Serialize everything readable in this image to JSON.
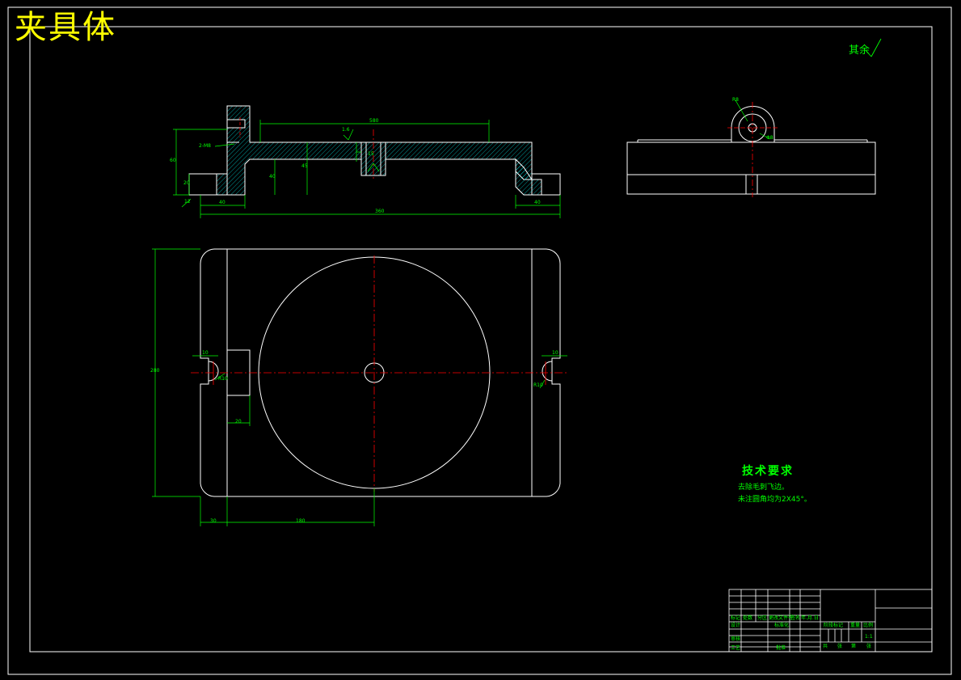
{
  "drawing": {
    "title": "夹具体",
    "roughness_note": "其余",
    "tech_requirements": {
      "title": "技术要求",
      "lines": [
        "去除毛刺飞边。",
        "未注圆角均为2X45°。"
      ]
    },
    "dimensions": {
      "section_top_width": "580",
      "section_overall_length": "360",
      "section_left_end": "40",
      "section_right_end": "40",
      "section_height": "60",
      "section_base_height": "20",
      "section_mid_height": "40",
      "section_inner_height": "45",
      "section_roughness_left": "12",
      "section_roughness_mid": "1.6",
      "section_bore_depth": "15",
      "section_angle": "2-M8",
      "plan_height": "280",
      "plan_left_offset": "30",
      "plan_center_offset": "180",
      "plan_slot_width": "20",
      "plan_right_slot": "10",
      "plan_left_slot": "10",
      "plan_key_width": "20",
      "plan_left_radius": "R10",
      "plan_right_radius": "R10",
      "side_radius": "R8",
      "side_hole": "Φ8"
    },
    "title_block": {
      "row_labels": [
        "标记",
        "处数",
        "分区",
        "更改文件号",
        "签名",
        "年.月.日"
      ],
      "design_label": "设计",
      "standard_label": "标准化",
      "review_label": "审核",
      "process_label": "工艺",
      "approve_label": "批准",
      "stage_label": "阶段标记",
      "weight_label": "重量",
      "scale_label": "比例",
      "scale_value": "1:1",
      "sheet_label": "共",
      "sheet_of_label": "张",
      "sheet_num_label": "第",
      "sheet_num_suffix": "张"
    }
  },
  "colors": {
    "outline": "#ffffff",
    "dimension": "#00ff00",
    "centerline": "#ff0000",
    "title": "#ffff00",
    "hatch": "#00ffff",
    "leader": "#ffffff"
  }
}
